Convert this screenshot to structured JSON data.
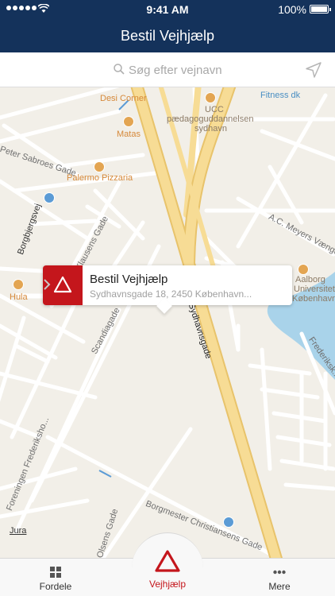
{
  "status_bar": {
    "time": "9:41 AM",
    "battery_percent": "100%"
  },
  "nav": {
    "title": "Bestil Vejhjælp"
  },
  "search": {
    "placeholder": "Søg efter vejnavn"
  },
  "map": {
    "labels": {
      "desi_corner": "Desi Corner",
      "ucc_1": "UCC",
      "ucc_2": "pædagoguddannelsen",
      "ucc_3": "sydhavn",
      "fitness": "Fitness dk",
      "matas": "Matas",
      "peter_sabroes": "Peter Sabroes Gade",
      "palermo": "Palermo Pizzaria",
      "borgbjergsvej": "Borgbjergsvej",
      "klausens": "M. Klausens Gade",
      "ac_meyers": "A.C. Meyers Vænge",
      "aalborg_1": "Aalborg",
      "aalborg_2": "Universitet",
      "aalborg_3": "København",
      "hula": "Hula",
      "scandiagade": "Scandiagade",
      "sydhavnsgade": "Sydhavnsgade",
      "frederiks": "Frederiksk...",
      "foreningen": "Foreningen Frederiksho...",
      "jura": "Jura",
      "borgmester": "Borgmester Christiansens Gade",
      "olsens": "Olsens Gade"
    }
  },
  "callout": {
    "title": "Bestil Vejhjælp",
    "address": "Sydhavnsgade 18, 2450 København..."
  },
  "tabs": {
    "fordele": "Fordele",
    "vejhjaelp": "Vejhjælp",
    "mere": "Mere"
  },
  "colors": {
    "header": "#14325b",
    "accent": "#c4161c",
    "road_major": "#f7dc95",
    "water": "#a9d3ea"
  }
}
